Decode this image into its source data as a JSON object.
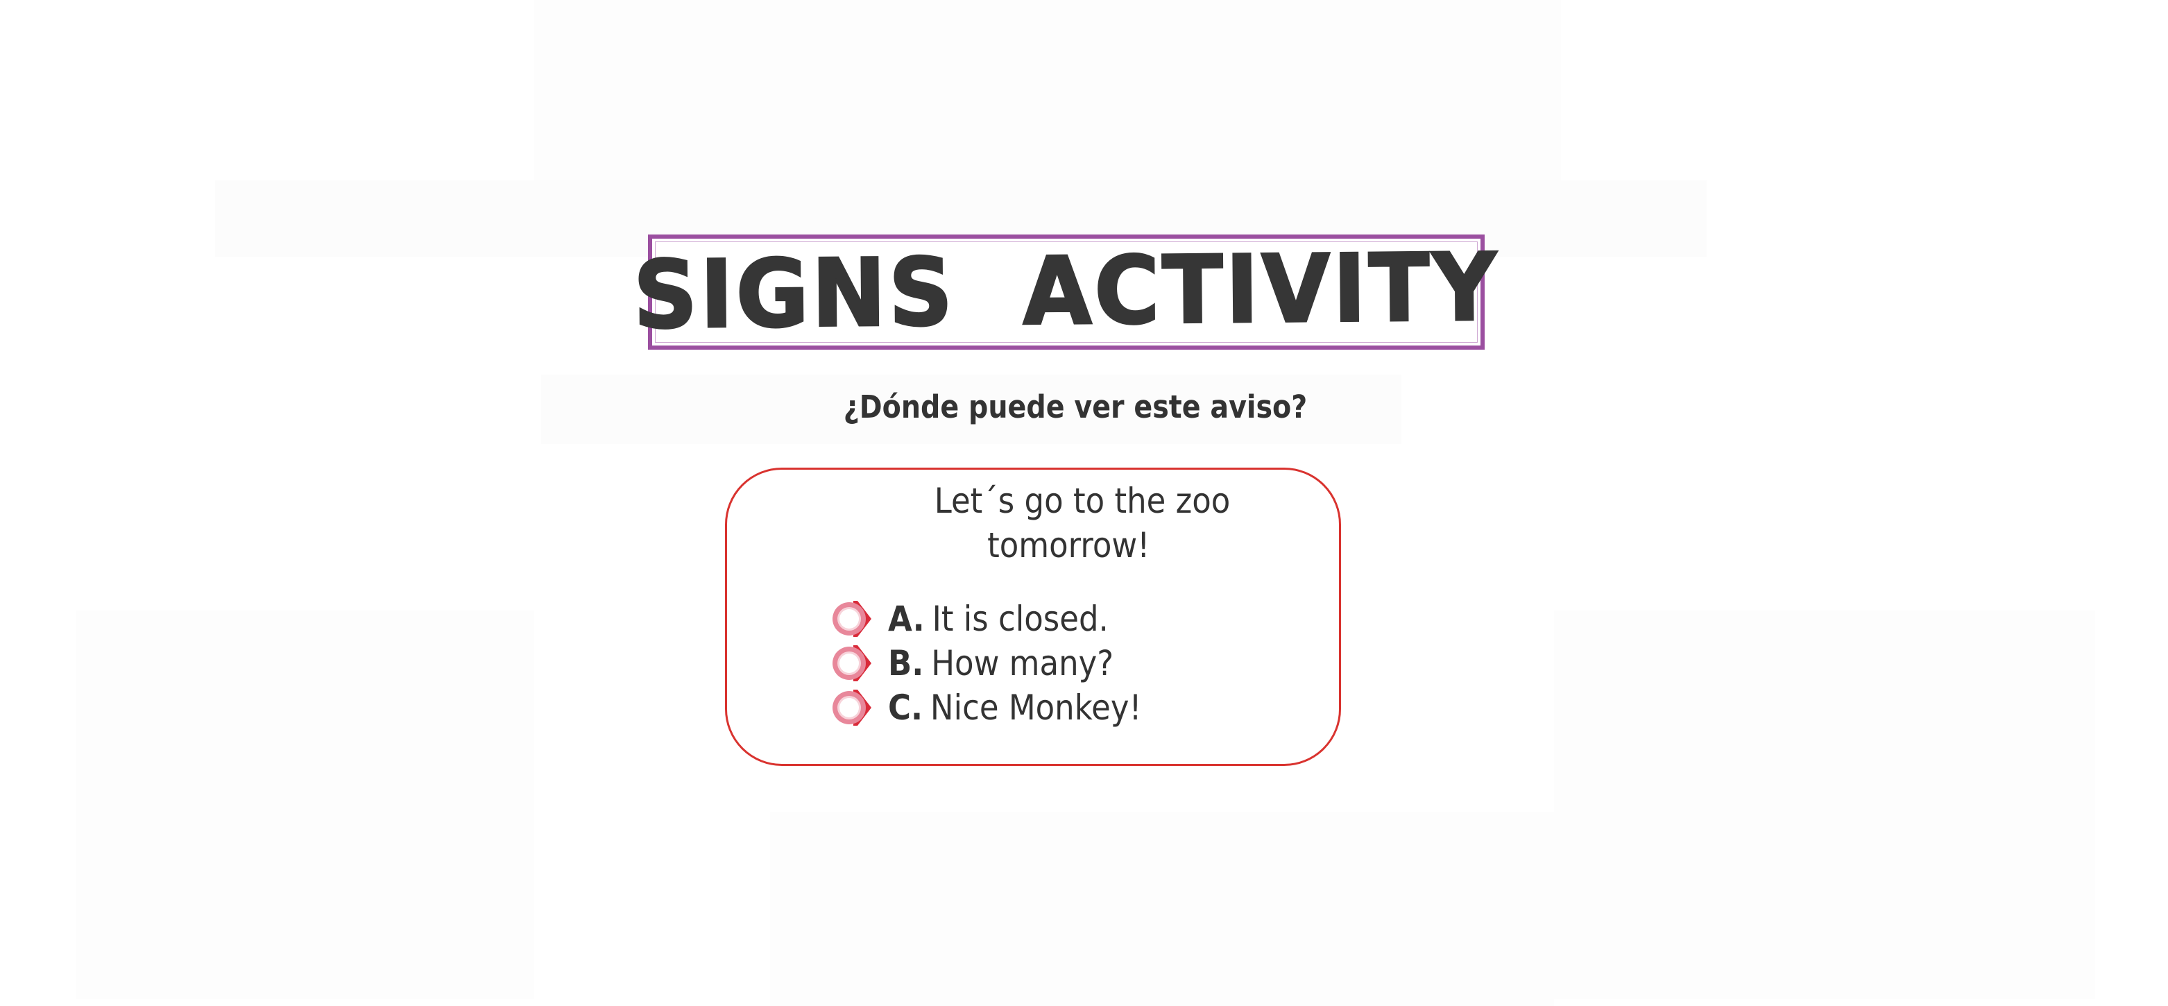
{
  "title": "SIGNS  ACTIVITY",
  "question": "¿Dónde puede ver este aviso?",
  "sign": {
    "line1": "Let´s go to the zoo",
    "line2": "tomorrow!"
  },
  "options": [
    {
      "letter": "A.",
      "text": "It is closed."
    },
    {
      "letter": "B.",
      "text": "How many?"
    },
    {
      "letter": "C.",
      "text": "Nice Monkey!"
    }
  ],
  "colors": {
    "title_frame": "#9b4fa0",
    "card_border": "#d9332f",
    "radio_ring": "#e8879a",
    "radio_accent": "#d92b3a",
    "text": "#333333"
  },
  "icons": {
    "radio": "radio-option-icon"
  }
}
